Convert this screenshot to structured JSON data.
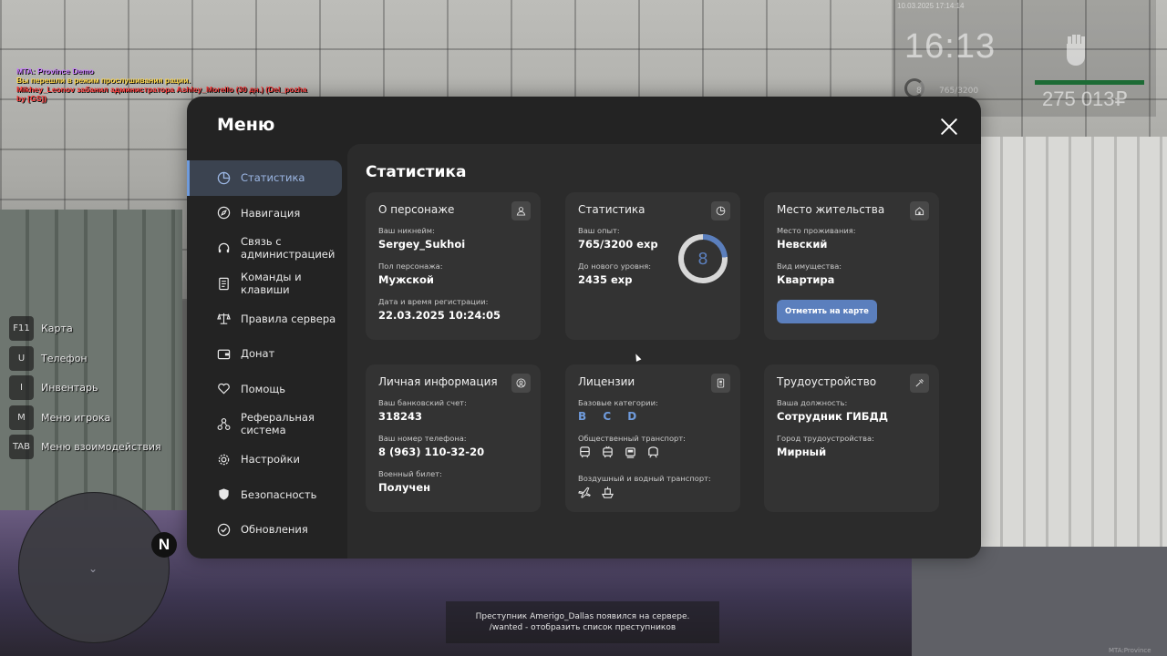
{
  "hud": {
    "chat": [
      "MTA: Province Demo",
      "Вы перешли в режим прослушивания рации.",
      "Mikhey_Leonov забанил администратора Ashley_Morello (30 дн.) (Del_pozha by [GS])"
    ],
    "date": "10.03.2025 17:14:14",
    "time": "16:13",
    "level": "8",
    "exp": "765/3200",
    "money": "275 013₽",
    "bar_color": "#1d6b35",
    "keys": [
      {
        "key": "F11",
        "label": "Карта"
      },
      {
        "key": "U",
        "label": "Телефон"
      },
      {
        "key": "I",
        "label": "Инвентарь"
      },
      {
        "key": "M",
        "label": "Меню игрока"
      },
      {
        "key": "TAB",
        "label": "Меню взоимодействия"
      }
    ],
    "compass": "N",
    "notice_line1": "Преступник Amerigo_Dallas появился на сервере.",
    "notice_line2": "/wanted - отобразить список преступников",
    "watermark": "MTA:Province"
  },
  "menu": {
    "title": "Меню",
    "close_icon": "close-icon",
    "accent": "#6f9bdc",
    "sidebar": [
      {
        "label": "Статистика",
        "icon": "chart-pie-icon",
        "active": true
      },
      {
        "label": "Навигация",
        "icon": "compass-icon"
      },
      {
        "label": "Связь с администрацией",
        "icon": "headset-icon"
      },
      {
        "label": "Команды и клавиши",
        "icon": "document-icon"
      },
      {
        "label": "Правила сервера",
        "icon": "scales-icon"
      },
      {
        "label": "Донат",
        "icon": "wallet-icon"
      },
      {
        "label": "Помощь",
        "icon": "heart-hand-icon"
      },
      {
        "label": "Реферальная система",
        "icon": "network-icon"
      },
      {
        "label": "Настройки",
        "icon": "gear-icon"
      },
      {
        "label": "Безопасность",
        "icon": "shield-icon"
      },
      {
        "label": "Обновления",
        "icon": "check-circle-icon"
      }
    ],
    "content_title": "Статистика",
    "cards": {
      "character": {
        "title": "О персонаже",
        "nick_label": "Ваш никнейм:",
        "nick": "Sergey_Sukhoi",
        "sex_label": "Пол персонажа:",
        "sex": "Мужской",
        "reg_label": "Дата и время регистрации:",
        "reg": "22.03.2025 10:24:05"
      },
      "stats": {
        "title": "Статистика",
        "exp_label": "Ваш опыт:",
        "exp": "765/3200 exp",
        "next_label": "До нового уровня:",
        "next": "2435 exp",
        "level": "8",
        "progress": 0.24
      },
      "residence": {
        "title": "Место жительства",
        "place_label": "Место проживания:",
        "place": "Невский",
        "type_label": "Вид имущества:",
        "type": "Квартира",
        "button": "Отметить на карте"
      },
      "personal": {
        "title": "Личная информация",
        "bank_label": "Ваш банковский счет:",
        "bank": "318243",
        "phone_label": "Ваш номер телефона:",
        "phone": "8 (963) 110-32-20",
        "military_label": "Военный билет:",
        "military": "Получен"
      },
      "licenses": {
        "title": "Лицензии",
        "base_label": "Базовые категории:",
        "base": "B C D",
        "public_label": "Общественный транспорт:",
        "air_label": "Воздушный и водный транспорт:"
      },
      "job": {
        "title": "Трудоустройство",
        "position_label": "Ваша должность:",
        "position": "Сотрудник ГИБДД",
        "city_label": "Город трудоустройства:",
        "city": "Мирный"
      }
    }
  }
}
